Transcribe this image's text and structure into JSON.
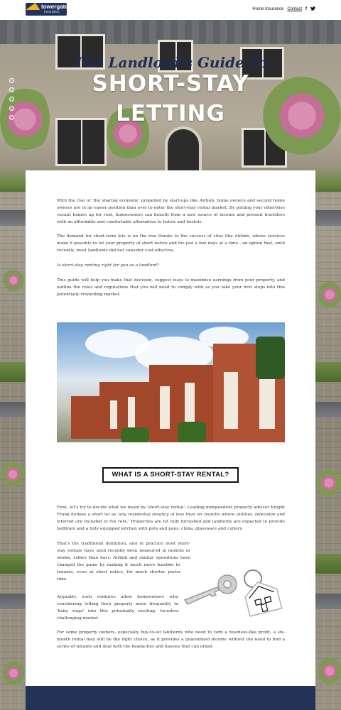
{
  "header": {
    "logo_text": "towergate",
    "logo_sub": "insurance",
    "nav": [
      "Home Insurance",
      "Contact"
    ],
    "social_icons": [
      "facebook-icon",
      "twitter-icon"
    ]
  },
  "hero": {
    "title": "The Landlord's Guide To",
    "line1": "SHORT-STAY",
    "line2": "LETTING",
    "slider_dots": 5
  },
  "article": {
    "p1": "With the rise of 'the sharing economy' propelled by start-ups like Airbnb, home owners and second home owners are in an easier position than ever to enter the short-stay rental market. By putting your otherwise vacant homes up for rent, homeowners can benefit from a new source of income and present travellers with an affordable and comfortable alternative to hotels and hostels.",
    "p2": "The demand for short-term lets is on the rise thanks to the success of sites like Airbnb, whose services make it possible to let your property at short notice and for just a few days at a time - an option that, until recently, most landlords did not consider cost-effective.",
    "p3": "Is short-stay renting right for you as a landlord?",
    "p4": "This guide will help you make that decision, suggest ways to maximise earnings from your property, and outline the rules and regulations that you will need to comply with as you take your first steps into this potentially rewarding market.",
    "section_heading": "WHAT IS A SHORT-STAY RENTAL?",
    "p5_a": "First, let's try to decide what we mean by 'short-stay rental'. Leading independent property adviser Knight Frank defines a short let as ",
    "p5_italic": "'any residential tenancy of less than six months where utilities, television and internet are included in the rent.'",
    "p5_b": " Properties are let fully furnished and landlords are expected to provide bedlinen and a fully equipped kitchen with pots and pans, china, glassware and cutlery.",
    "p6": "That's the traditional definition, and in practice most short-stay rentals have until recently been measured in months or weeks, rather than days. Airbnb and similar operations have changed the game by making it much more feasible to find tenants, even at short notice, for much shorter periods of time.",
    "p7": "Arguably, such ventures allow homeowners who are considering letting their property more frequently to take 'baby steps' into this potentially exciting, lucrative and challenging market.",
    "p8": "For some property owners, especially buy-to-let landlords who need to turn a business-like profit, a six-month rental may still be the right choice, as it provides a guaranteed income without the need to find a series of tenants and deal with the headaches and hassles that can entail."
  },
  "colors": {
    "navy": "#243257",
    "title_navy": "#1e2b55",
    "logo_gold": "#f2b51c"
  }
}
